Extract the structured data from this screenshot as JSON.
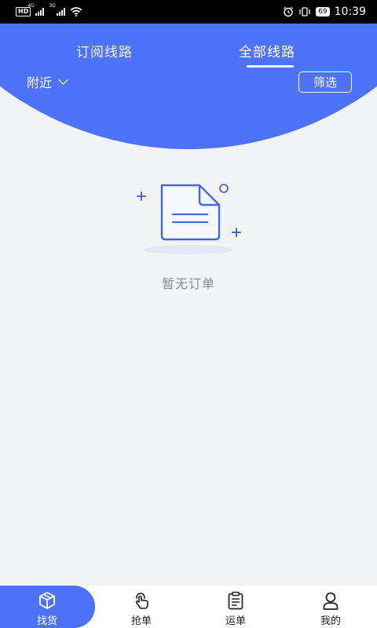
{
  "status_bar": {
    "network_badge": "HD",
    "signal_1_label": "4G",
    "signal_2_label": "3G",
    "battery": "69",
    "time": "10:39"
  },
  "header": {
    "tabs": [
      {
        "label": "订阅线路",
        "active": false
      },
      {
        "label": "全部线路",
        "active": true
      }
    ],
    "location_label": "附近",
    "filter_label": "筛选"
  },
  "empty_state": {
    "message": "暂无订单"
  },
  "bottom_nav": {
    "items": [
      {
        "label": "找货",
        "icon": "package-icon",
        "active": true
      },
      {
        "label": "抢单",
        "icon": "hand-tap-icon",
        "active": false
      },
      {
        "label": "运单",
        "icon": "clipboard-icon",
        "active": false
      },
      {
        "label": "我的",
        "icon": "person-icon",
        "active": false
      }
    ]
  },
  "colors": {
    "primary": "#4f73f8",
    "background": "#f3f4f8"
  }
}
